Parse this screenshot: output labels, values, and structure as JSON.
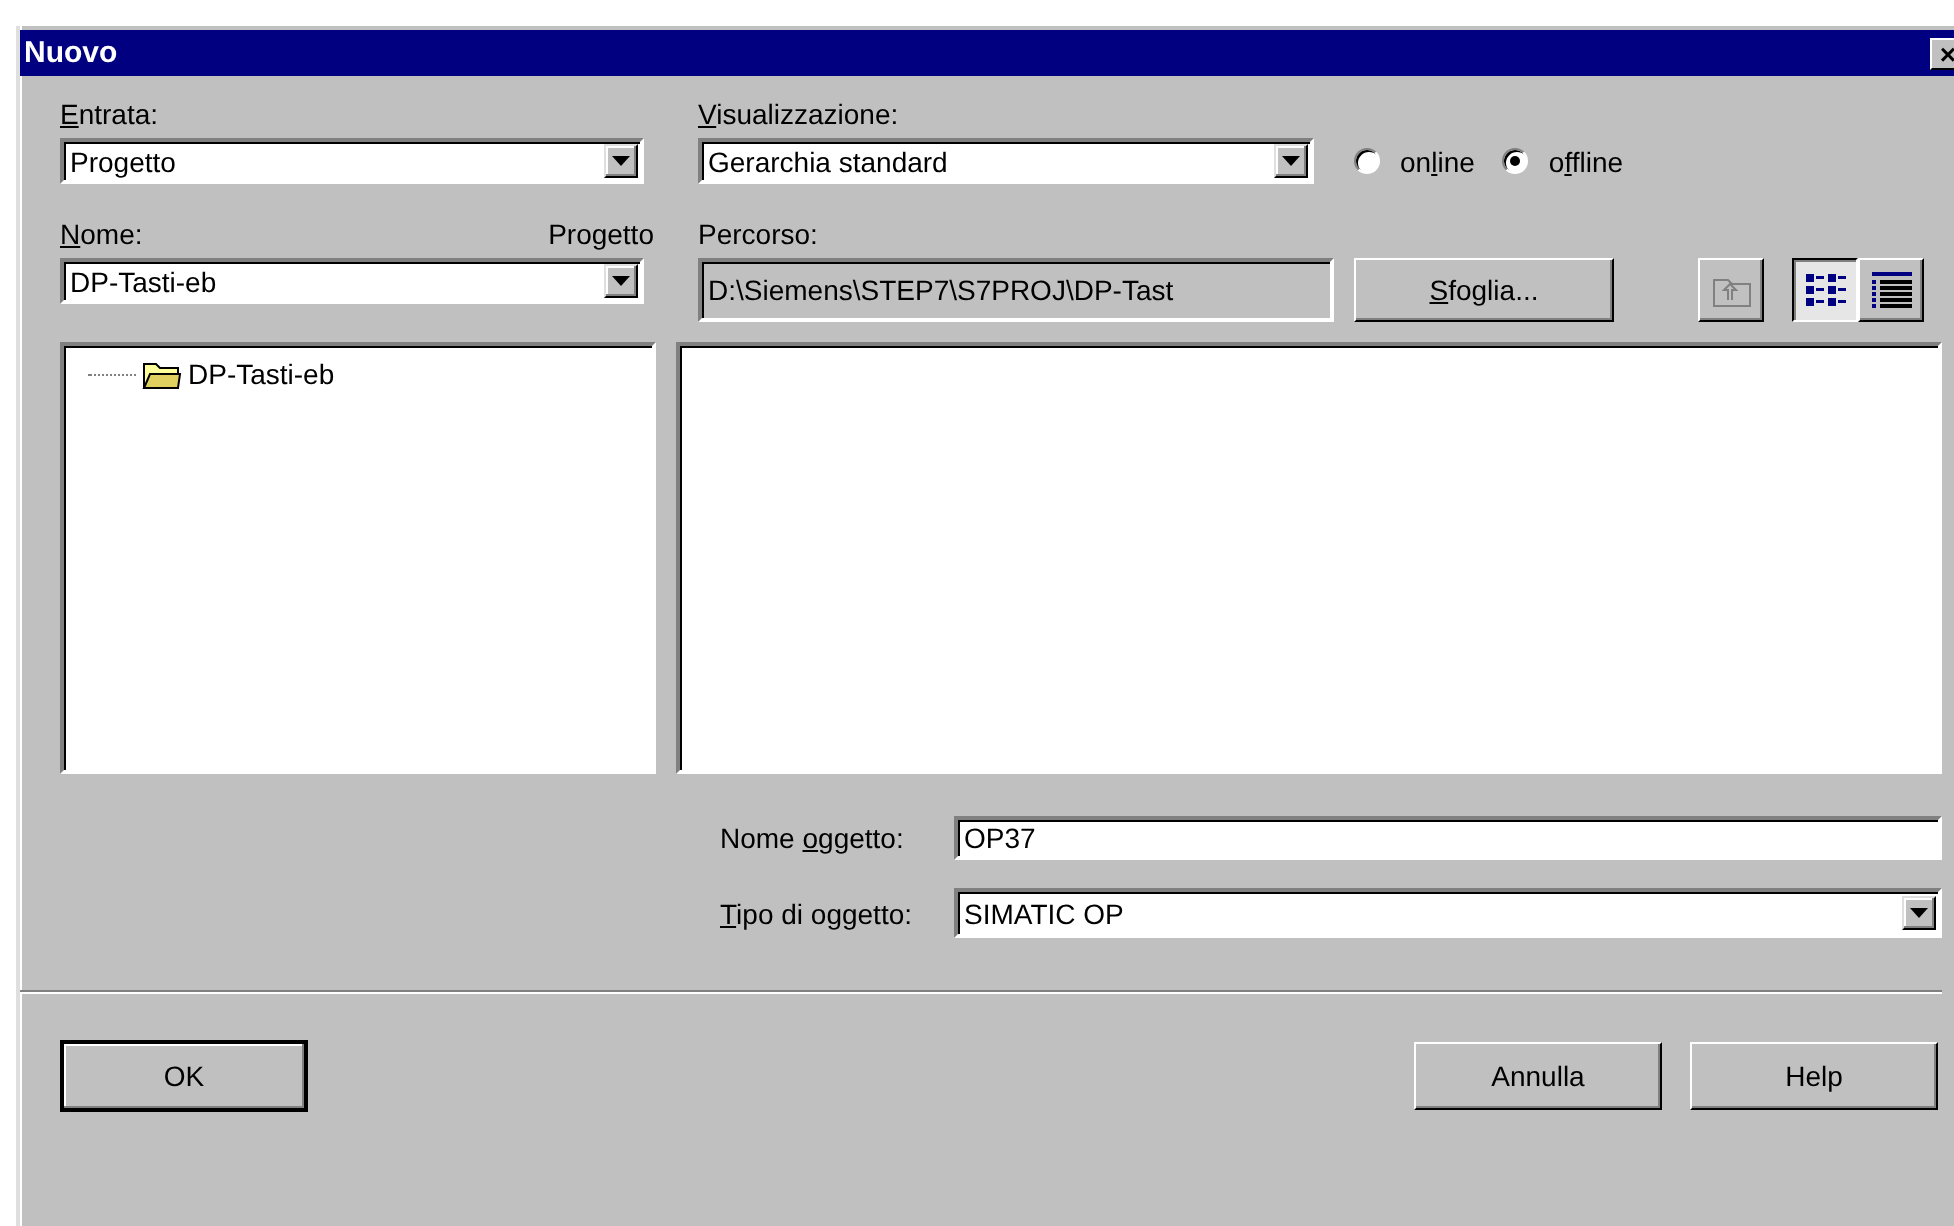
{
  "window": {
    "title": "Nuovo",
    "close": "×"
  },
  "entry": {
    "label": {
      "key": "E",
      "post": "ntrata:"
    },
    "value": "Progetto"
  },
  "view": {
    "label": {
      "key": "V",
      "post": "isualizzazione:"
    },
    "value": "Gerarchia standard"
  },
  "mode": [
    {
      "label": {
        "pre": "on",
        "key": "l",
        "post": "ine"
      },
      "selected": false
    },
    {
      "label": {
        "pre": "o",
        "key": "f",
        "post": "fline"
      },
      "selected": true
    }
  ],
  "name": {
    "label": {
      "key": "N",
      "post": "ome:"
    },
    "type_label": "Progetto",
    "value": "DP-Tasti-eb"
  },
  "path": {
    "label": "Percorso:",
    "value": "D:\\Siemens\\STEP7\\S7PROJ\\DP-Tast",
    "browse": {
      "key": "S",
      "post": "foglia..."
    }
  },
  "view_buttons": [
    {
      "kind": "up",
      "selected": false,
      "disabled": true
    },
    {
      "kind": "icons",
      "selected": true
    },
    {
      "kind": "details",
      "selected": false
    }
  ],
  "tree": [
    {
      "label": "DP-Tasti-eb"
    }
  ],
  "object_name": {
    "label": {
      "pre": "Nome ",
      "key": "o",
      "post": "ggetto:"
    },
    "value": "OP37"
  },
  "object_type": {
    "label": {
      "key": "T",
      "post": "ipo di oggetto:"
    },
    "value": "SIMATIC OP"
  },
  "buttons": [
    {
      "label": "OK",
      "kind": "default"
    },
    {
      "label": "Annulla",
      "kind": "normal"
    },
    {
      "label": "Help",
      "kind": "normal"
    }
  ]
}
